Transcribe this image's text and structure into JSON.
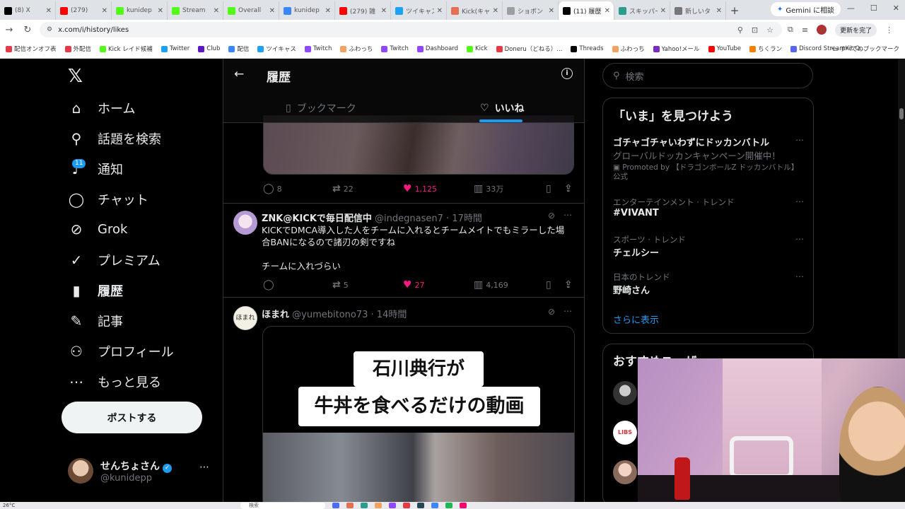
{
  "browser": {
    "tabs": [
      {
        "title": "(8) X",
        "color": "#000000"
      },
      {
        "title": "(279)",
        "color": "#ff0000"
      },
      {
        "title": "kunidep",
        "color": "#53fc18"
      },
      {
        "title": "Stream",
        "color": "#53fc18"
      },
      {
        "title": "Overall",
        "color": "#53fc18"
      },
      {
        "title": "kunidep",
        "color": "#3a86ff"
      },
      {
        "title": "(279) 雑",
        "color": "#ff0000"
      },
      {
        "title": "ツイキャス",
        "color": "#1da1f2"
      },
      {
        "title": "Kick(キャ",
        "color": "#e76f51"
      },
      {
        "title": "ショボン",
        "color": "#9e9e9e"
      },
      {
        "title": "(11) 履歴",
        "color": "#000000",
        "active": true
      },
      {
        "title": "スキッパー",
        "color": "#2a9d8f"
      },
      {
        "title": "新しいタ",
        "color": "#777777"
      }
    ],
    "gemini_label": "Gemini に相談",
    "url": "x.com/i/history/likes",
    "update_label": "更新を完了",
    "bookmarks": [
      {
        "label": "配信オンオフ表",
        "color": "#e63946"
      },
      {
        "label": "外配信",
        "color": "#e63946"
      },
      {
        "label": "Kick レイド候補",
        "color": "#53fc18"
      },
      {
        "label": "Twitter",
        "color": "#1da1f2"
      },
      {
        "label": "Club",
        "color": "#5c16c5"
      },
      {
        "label": "配信",
        "color": "#3a86ff"
      },
      {
        "label": "ツイキャス",
        "color": "#1da1f2"
      },
      {
        "label": "Twitch",
        "color": "#9146ff"
      },
      {
        "label": "ふわっち",
        "color": "#f4a261"
      },
      {
        "label": "Twitch",
        "color": "#9146ff"
      },
      {
        "label": "Dashboard",
        "color": "#9146ff"
      },
      {
        "label": "Kick",
        "color": "#53fc18"
      },
      {
        "label": "Doneru（どねる）...",
        "color": "#e63946"
      },
      {
        "label": "Threads",
        "color": "#000000"
      },
      {
        "label": "ふわっち",
        "color": "#f4a261"
      },
      {
        "label": "Yahoo!メール",
        "color": "#7b2cbf"
      },
      {
        "label": "YouTube",
        "color": "#ff0000"
      },
      {
        "label": "ちくラン",
        "color": "#f77f00"
      },
      {
        "label": "Discord StreamKit O...",
        "color": "#5865f2"
      }
    ],
    "all_bookmarks_label": "すべてのブックマーク"
  },
  "nav": {
    "items": [
      {
        "label": "ホーム",
        "icon": "home-icon",
        "glyph": "⌂"
      },
      {
        "label": "話題を検索",
        "icon": "search-icon",
        "glyph": "⚲"
      },
      {
        "label": "通知",
        "icon": "bell-icon",
        "glyph": "♪"
      },
      {
        "label": "チャット",
        "icon": "chat-icon",
        "glyph": "◯"
      },
      {
        "label": "Grok",
        "icon": "grok-icon",
        "glyph": "⊘"
      },
      {
        "label": "プレミアム",
        "icon": "verified-icon",
        "glyph": "✓"
      },
      {
        "label": "履歴",
        "icon": "bookmark-icon",
        "glyph": "▮"
      },
      {
        "label": "記事",
        "icon": "article-icon",
        "glyph": "✎"
      },
      {
        "label": "プロフィール",
        "icon": "profile-icon",
        "glyph": "⚇"
      },
      {
        "label": "もっと見る",
        "icon": "more-icon",
        "glyph": "⋯"
      }
    ],
    "notif_count": "11",
    "post_label": "ポストする",
    "account": {
      "name": "せんちょさん",
      "handle": "@kunidepp"
    }
  },
  "header": {
    "title": "履歴",
    "tabs": {
      "bookmarks": "ブックマーク",
      "likes": "いいね"
    }
  },
  "tweets": [
    {
      "replies": "8",
      "retweets": "22",
      "likes": "1,125",
      "views": "33万"
    },
    {
      "name": "ZNK@KICKで毎日配信中",
      "handle": "@indegnasen7",
      "time": "· 17時間",
      "text1": "KICKでDMCA導入した人をチームに入れるとチームメイトでもミラーした場",
      "text2": "合BANになるので諸刃の剣ですね",
      "text3": "チームに入れづらい",
      "replies": "",
      "retweets": "5",
      "likes": "27",
      "views": "4,169"
    },
    {
      "name": "ほまれ",
      "handle": "@yumebitono73",
      "time": "· 14時間",
      "caption1": "石川典行が",
      "caption2": "牛丼を食べるだけの動画"
    }
  ],
  "right": {
    "search_placeholder": "検索",
    "trends_title": "「いま」を見つけよう",
    "trends": [
      {
        "meta": "",
        "name": "ゴチャゴチャいわずにドッカンバトル",
        "desc": "グローバルドッカンキャンペーン開催中！",
        "promo": "Promoted by 【ドラゴンボールZ ドッカンバトル】公式"
      },
      {
        "meta": "エンターテインメント · トレンド",
        "name": "#VIVANT"
      },
      {
        "meta": "スポーツ · トレンド",
        "name": "チェルシー"
      },
      {
        "meta": "日本のトレンド",
        "name": "野崎さん"
      }
    ],
    "show_more": "さらに表示",
    "who_to_follow": "おすすめユーザー"
  },
  "taskbar": {
    "temp": "26°C",
    "search": "検索"
  },
  "colors": {
    "accent": "#1d9bf0",
    "like": "#f91880",
    "bg": "#000000"
  }
}
